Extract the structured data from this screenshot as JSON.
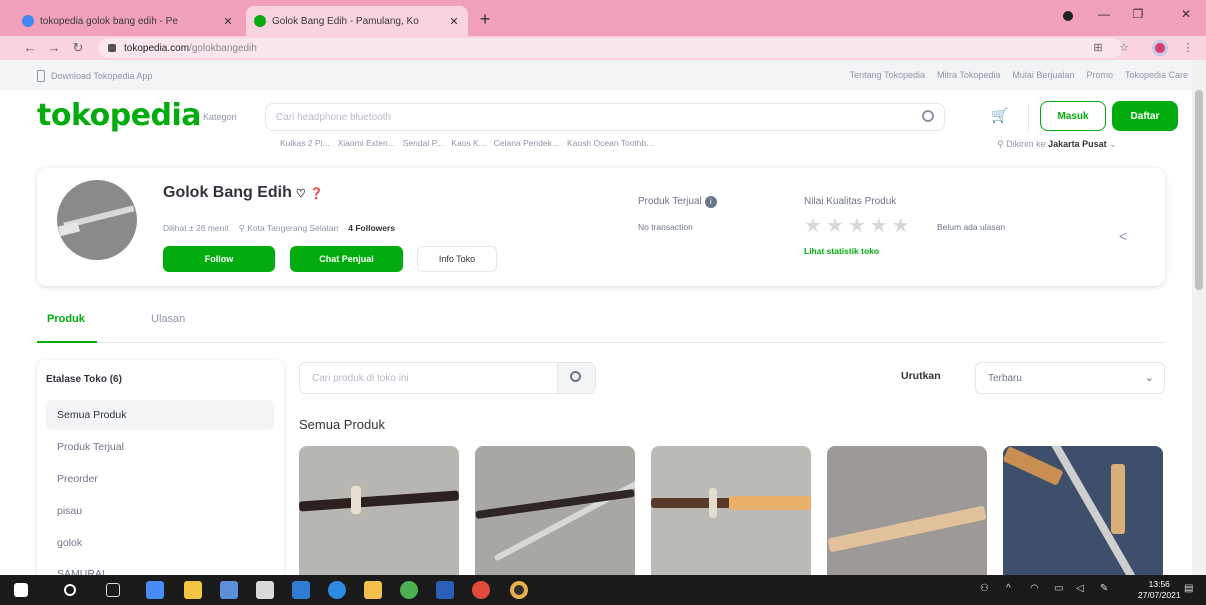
{
  "browser": {
    "tabs": [
      {
        "title": "tokopedia golok bang edih - Pe",
        "active": false
      },
      {
        "title": "Golok Bang Edih - Pamulang, Ko",
        "active": true
      }
    ],
    "url_domain": "tokopedia.com",
    "url_path": "/golokbangedih"
  },
  "topstrip": {
    "app": "Download Tokopedia App",
    "links": [
      "Tentang Tokopedia",
      "Mitra Tokopedia",
      "Mulai Berjualan",
      "Promo",
      "Tokopedia Care"
    ]
  },
  "header": {
    "logo": "tokopedia",
    "kategori": "Kategori",
    "search_placeholder": "Cari headphone bluetooth",
    "keywords": [
      "Kulkas 2 Pi...",
      "Xiaomi Exten...",
      "Sendal P...",
      "Kaos K...",
      "Celana Pendek...",
      "Kaosh Ocean Toothb..."
    ],
    "masuk": "Masuk",
    "daftar": "Daftar",
    "loc_prefix": "Dikirim ke",
    "loc_city": "Jakarta Pusat"
  },
  "shop": {
    "name": "Golok Bang Edih",
    "online": "Dilihat ± 26 menit",
    "location": "Kota Tangerang Selatan",
    "followers": "4 Followers",
    "follow": "Follow",
    "chat": "Chat Penjual",
    "info": "Info Toko",
    "produk_terjual_label": "Produk Terjual",
    "produk_terjual_val": "No transaction",
    "nilai_label": "Nilai Kualitas Produk",
    "rating_stars": 0,
    "no_review": "Belum ada ulasan",
    "stat_link": "Lihat statistik toko"
  },
  "shoptabs": {
    "produk": "Produk",
    "ulasan": "Ulasan"
  },
  "etalase": {
    "title": "Etalase Toko (6)",
    "items": [
      "Semua Produk",
      "Produk Terjual",
      "Preorder",
      "pisau",
      "golok",
      "SAMURAI"
    ]
  },
  "products": {
    "search_placeholder": "Cari produk di toko ini",
    "sort_label": "Urutkan",
    "sort_value": "Terbaru",
    "section_title": "Semua Produk"
  },
  "taskbar": {
    "time": "13:56",
    "date": "27/07/2021"
  },
  "colors": {
    "brand": "#03ac0e",
    "tabbar": "#f2a1bb"
  }
}
